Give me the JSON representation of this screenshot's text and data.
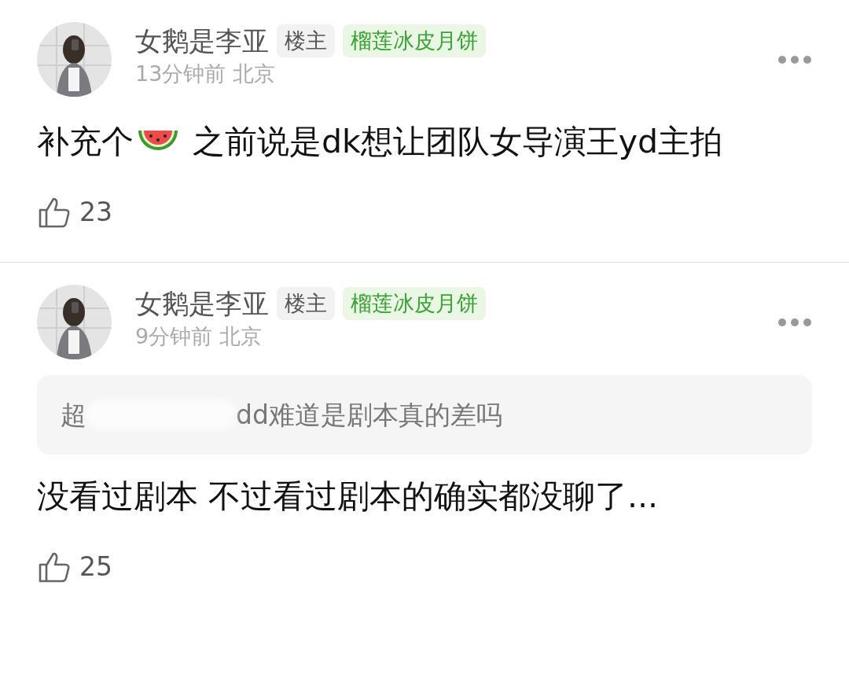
{
  "comments": [
    {
      "author": "女鹅是李亚",
      "badges": [
        {
          "kind": "role",
          "label": "楼主"
        },
        {
          "kind": "fan",
          "label": "榴莲冰皮月饼"
        }
      ],
      "time": "13分钟前",
      "location": "北京",
      "body": [
        {
          "kind": "text",
          "text": "补充个"
        },
        {
          "kind": "emoji"
        },
        {
          "kind": "text",
          "text": " 之前说是dk想让团队女导演王yd主拍"
        }
      ],
      "likes": "23"
    },
    {
      "author": "女鹅是李亚",
      "badges": [
        {
          "kind": "role",
          "label": "楼主"
        },
        {
          "kind": "fan",
          "label": "榴莲冰皮月饼"
        }
      ],
      "time": "9分钟前",
      "location": "北京",
      "quote": {
        "lead": "超",
        "rest": "dd难道是剧本真的差吗"
      },
      "body": [
        {
          "kind": "text",
          "text": "没看过剧本 不过看过剧本的确实都没聊了..."
        }
      ],
      "likes": "25"
    }
  ]
}
